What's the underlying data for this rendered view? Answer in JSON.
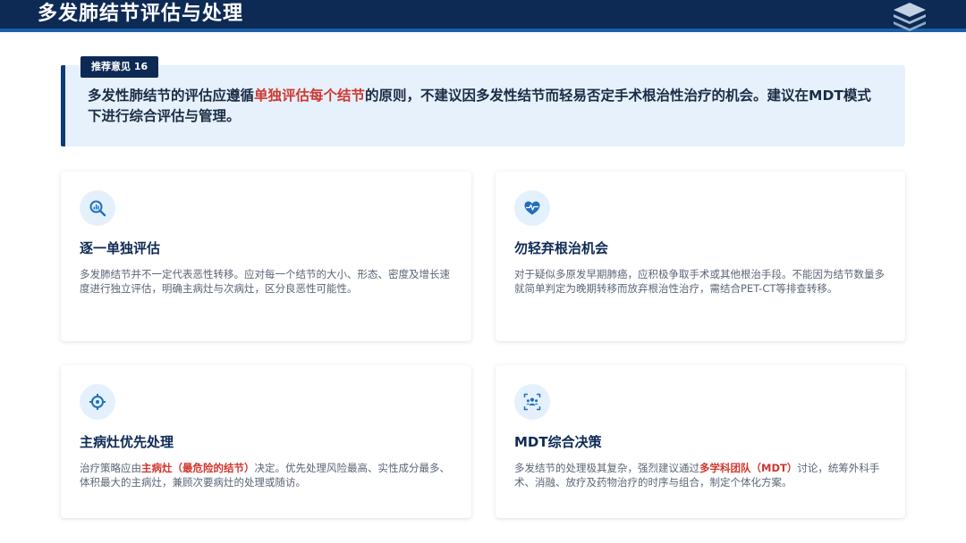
{
  "header": {
    "title": "多发肺结节评估与处理",
    "icon": "layers-icon",
    "colors": {
      "bar": "#0d2a55",
      "accent_line": "#1b5fa8"
    }
  },
  "recommendation": {
    "badge": "推荐意见 16",
    "text_before": "多发性肺结节的评估应遵循",
    "highlight": "单独评估每个结节",
    "text_after": "的原则，不建议因多发性结节而轻易否定手术根治性治疗的机会。建议在MDT模式下进行综合评估与管理。",
    "highlight_color": "#d0372f"
  },
  "cards": [
    {
      "icon": "magnifier-chart-icon",
      "title": "逐一单独评估",
      "desc": "多发肺结节并不一定代表恶性转移。应对每一个结节的大小、形态、密度及增长速度进行独立评估，明确主病灶与次病灶，区分良恶性可能性。"
    },
    {
      "icon": "heart-pulse-icon",
      "title": "勿轻弃根治机会",
      "desc": "对于疑似多原发早期肺癌，应积极争取手术或其他根治手段。不能因为结节数量多就简单判定为晚期转移而放弃根治性治疗，需结合PET-CT等排查转移。"
    },
    {
      "icon": "crosshair-icon",
      "title": "主病灶优先处理",
      "desc_before": "治疗策略应由",
      "desc_highlight": "主病灶（最危险的结节）",
      "desc_after": "决定。优先处理风险最高、实性成分最多、体积最大的主病灶，兼顾次要病灶的处理或随访。"
    },
    {
      "icon": "team-icon",
      "title": "MDT综合决策",
      "desc_before": "多发结节的处理极其复杂，强烈建议通过",
      "desc_highlight": "多学科团队（MDT）",
      "desc_after": "讨论，统筹外科手术、消融、放疗及药物治疗的时序与组合，制定个体化方案。"
    }
  ]
}
